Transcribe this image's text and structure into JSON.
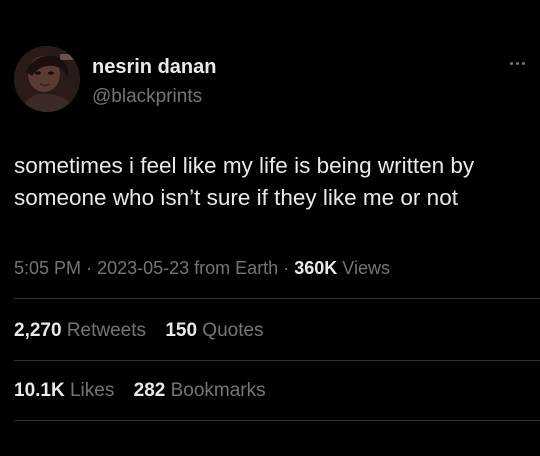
{
  "user": {
    "display_name": "nesrin danan",
    "handle": "@blackprints",
    "avatar_icon": "profile-photo"
  },
  "menu": {
    "icon": "more-horizontal-icon"
  },
  "tweet": {
    "lines": [
      "sometimes i feel like my life is being written by",
      "someone who isn’t sure if they like me or not"
    ]
  },
  "meta": {
    "time": "5:05 PM",
    "sep1": "·",
    "date": "2023-05-23",
    "source": "from Earth",
    "sep2": "·",
    "views_count": "360K",
    "views_label": "Views"
  },
  "stats_row1": {
    "retweets_count": "2,270",
    "retweets_label": "Retweets",
    "quotes_count": "150",
    "quotes_label": "Quotes"
  },
  "stats_row2": {
    "likes_count": "10.1K",
    "likes_label": "Likes",
    "bookmarks_count": "282",
    "bookmarks_label": "Bookmarks"
  },
  "colors": {
    "background": "#000000",
    "primary_text": "#e7e9ea",
    "secondary_text": "#71767b",
    "divider": "#2f3336"
  }
}
